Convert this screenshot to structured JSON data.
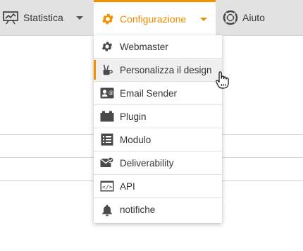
{
  "nav": {
    "statistics": {
      "label": "Statistica",
      "icon": "chart-board-icon"
    },
    "configuration": {
      "label": "Configurazione",
      "icon": "gear-icon",
      "accent": "#f39200"
    },
    "help": {
      "label": "Aiuto",
      "icon": "lifebuoy-icon"
    }
  },
  "menu": {
    "items": [
      {
        "label": "Webmaster",
        "icon": "gear-icon"
      },
      {
        "label": "Personalizza il design",
        "icon": "design-brushes-icon",
        "active": true
      },
      {
        "label": "Email Sender",
        "icon": "contact-card-icon"
      },
      {
        "label": "Plugin",
        "icon": "plugin-icon"
      },
      {
        "label": "Modulo",
        "icon": "form-list-icon"
      },
      {
        "label": "Deliverability",
        "icon": "envelope-check-icon"
      },
      {
        "label": "API",
        "icon": "code-window-icon"
      },
      {
        "label": "notifiche",
        "icon": "bell-icon"
      }
    ]
  },
  "colors": {
    "accent": "#f39200",
    "topbar": "#e2e2e2",
    "icon": "#4a4a4a"
  }
}
